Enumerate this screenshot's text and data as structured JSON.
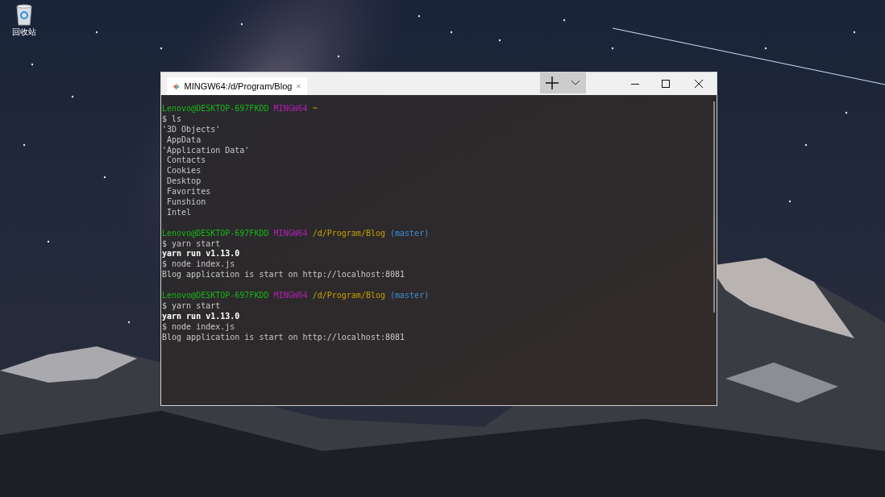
{
  "desktop": {
    "icons": [
      {
        "label": "回收站"
      }
    ]
  },
  "window": {
    "tab": {
      "title": "MINGW64:/d/Program/Blog",
      "selected": true
    },
    "lines": [
      {
        "kind": "prompt",
        "user": "Lenovo@DESKTOP-697FKDD",
        "host": "MINGW64",
        "path": "~"
      },
      {
        "kind": "output",
        "text": "$ ls"
      },
      {
        "kind": "output",
        "text": "'3D Objects'"
      },
      {
        "kind": "output",
        "text": " AppData"
      },
      {
        "kind": "output",
        "text": "'Application Data'"
      },
      {
        "kind": "output",
        "text": " Contacts"
      },
      {
        "kind": "output",
        "text": " Cookies"
      },
      {
        "kind": "output",
        "text": " Desktop"
      },
      {
        "kind": "output",
        "text": " Favorites"
      },
      {
        "kind": "output",
        "text": " Funshion"
      },
      {
        "kind": "output",
        "text": " Intel"
      },
      {
        "kind": "blank"
      },
      {
        "kind": "prompt",
        "user": "Lenovo@DESKTOP-697FKDD",
        "host": "MINGW64",
        "path": "/d/Program/Blog",
        "branch": "(master)"
      },
      {
        "kind": "output",
        "text": "$ yarn start"
      },
      {
        "kind": "bold",
        "text": "yarn run v1.13.0"
      },
      {
        "kind": "output",
        "text": "$ node index.js"
      },
      {
        "kind": "output",
        "text": "Blog application is start on http://localhost:8081"
      },
      {
        "kind": "blank"
      },
      {
        "kind": "prompt",
        "user": "Lenovo@DESKTOP-697FKDD",
        "host": "MINGW64",
        "path": "/d/Program/Blog",
        "branch": "(master)"
      },
      {
        "kind": "output",
        "text": "$ yarn start"
      },
      {
        "kind": "bold",
        "text": "yarn run v1.13.0"
      },
      {
        "kind": "output",
        "text": "$ node index.js"
      },
      {
        "kind": "output",
        "text": "Blog application is start on http://localhost:8081"
      }
    ]
  }
}
